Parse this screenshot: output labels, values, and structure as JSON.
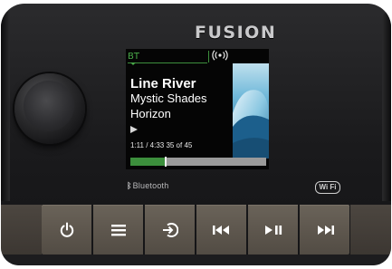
{
  "brand": "FUSION",
  "screen": {
    "source_label": "BT",
    "broadcast_icon": "((●))",
    "track_title": "Line River",
    "artist": "Mystic Shades",
    "album": "Horizon",
    "play_state_icon": "play-icon",
    "time_text": "1:11 / 4:33  35 of 45",
    "progress_fraction": 0.26,
    "accent_color": "#3c8f3c"
  },
  "labels": {
    "bluetooth": "Bluetooth",
    "wifi": "Wi Fi"
  },
  "buttons": [
    {
      "name": "power",
      "icon": "power-icon"
    },
    {
      "name": "menu",
      "icon": "menu-icon"
    },
    {
      "name": "source",
      "icon": "source-icon"
    },
    {
      "name": "previous",
      "icon": "previous-icon"
    },
    {
      "name": "play-pause",
      "icon": "play-pause-icon"
    },
    {
      "name": "next",
      "icon": "next-icon"
    }
  ]
}
